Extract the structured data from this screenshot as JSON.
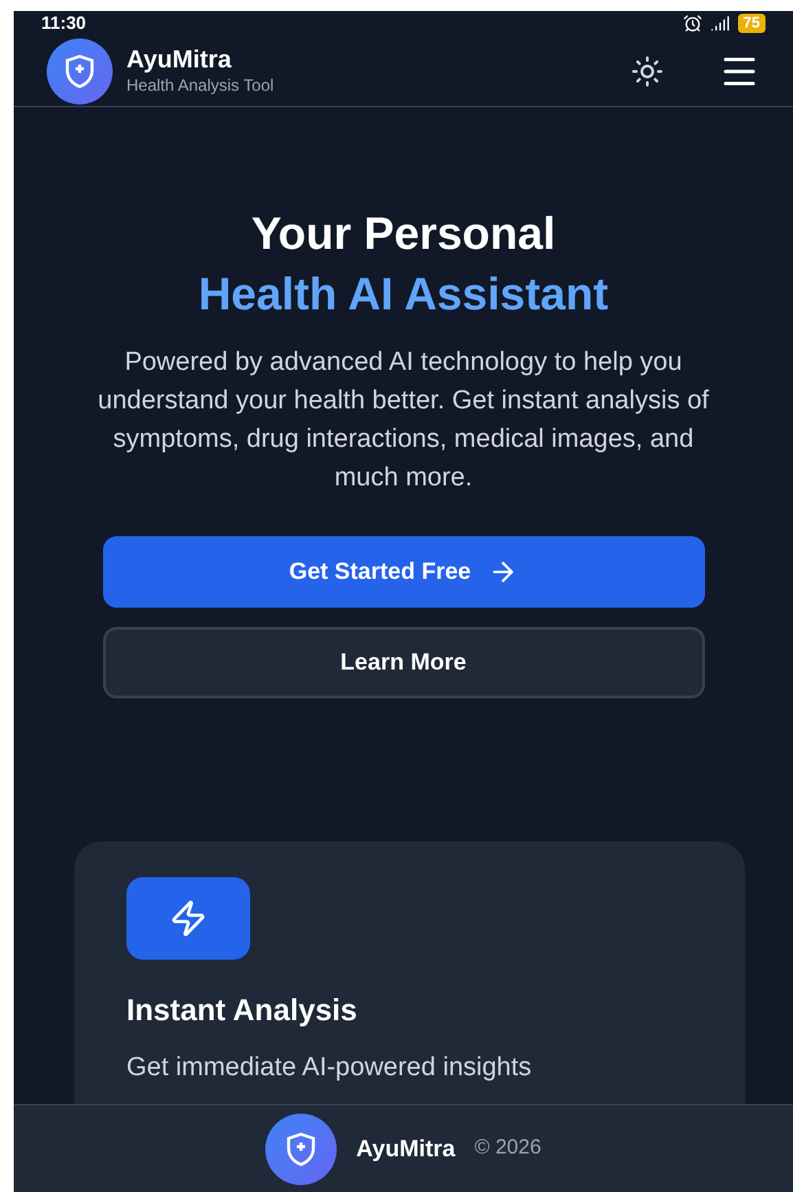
{
  "status_bar": {
    "time": "11:30",
    "battery": "75"
  },
  "header": {
    "brand": "AyuMitra",
    "subtitle": "Health Analysis Tool"
  },
  "hero": {
    "title": "Your Personal",
    "highlight": "Health AI Assistant",
    "description": "Powered by advanced AI technology to help you understand your health better. Get instant analysis of symptoms, drug interactions, medical images, and much more.",
    "buttons": [
      {
        "label": "Get Started Free",
        "kind": "primary"
      },
      {
        "label": "Learn More",
        "kind": "secondary"
      }
    ]
  },
  "features": [
    {
      "title": "Instant Analysis",
      "description": "Get immediate AI-powered insights"
    }
  ],
  "footer": {
    "brand": "AyuMitra",
    "copyright": "© 2026"
  }
}
